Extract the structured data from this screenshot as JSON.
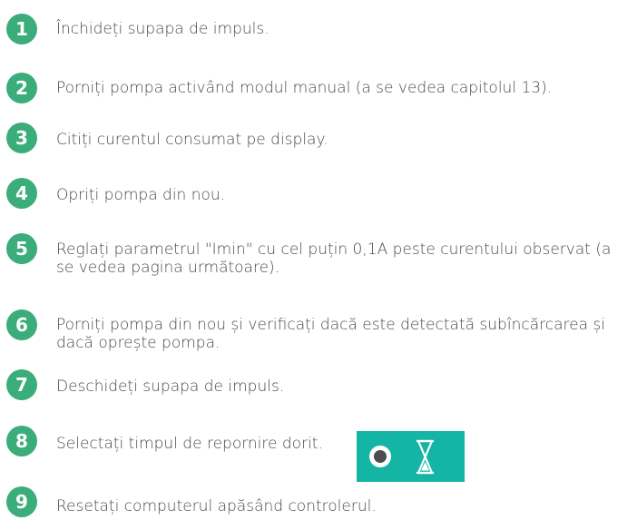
{
  "accent_color": "#3aad7a",
  "steps": [
    {
      "number": "1",
      "text": "Închideți supapa de impuls.",
      "color": "#3aad7a"
    },
    {
      "number": "2",
      "text": "Porniți pompa activând modul manual (a se vedea capitolul 13).",
      "color": "#3aad7a"
    },
    {
      "number": "3",
      "text": "Citiți curentul consumat pe display.",
      "color": "#3aad7a"
    },
    {
      "number": "4",
      "text": "Opriți pompa din nou.",
      "color": "#3aad7a"
    },
    {
      "number": "5",
      "text": "Reglați parametrul \"Imin\" cu cel puțin 0,1A peste curentului observat (a se vedea pagina următoare).",
      "color": "#3aad7a"
    },
    {
      "number": "6",
      "text": "Porniți pompa din nou și verificați dacă este detectată subîncărcarea și dacă oprește pompa.",
      "color": "#3aad7a"
    },
    {
      "number": "7",
      "text": "Deschideți supapa de impuls.",
      "color": "#3aad7a"
    },
    {
      "number": "8",
      "text": "Selectați timpul de repornire dorit.",
      "color": "#3aad7a"
    },
    {
      "number": "9",
      "text": "Resetați computerul apăsând controlerul.",
      "color": "#3aad7a"
    }
  ],
  "timer_panel": {
    "background": "#15b5a6",
    "icons": [
      "record-circle-icon",
      "hourglass-icon"
    ]
  }
}
